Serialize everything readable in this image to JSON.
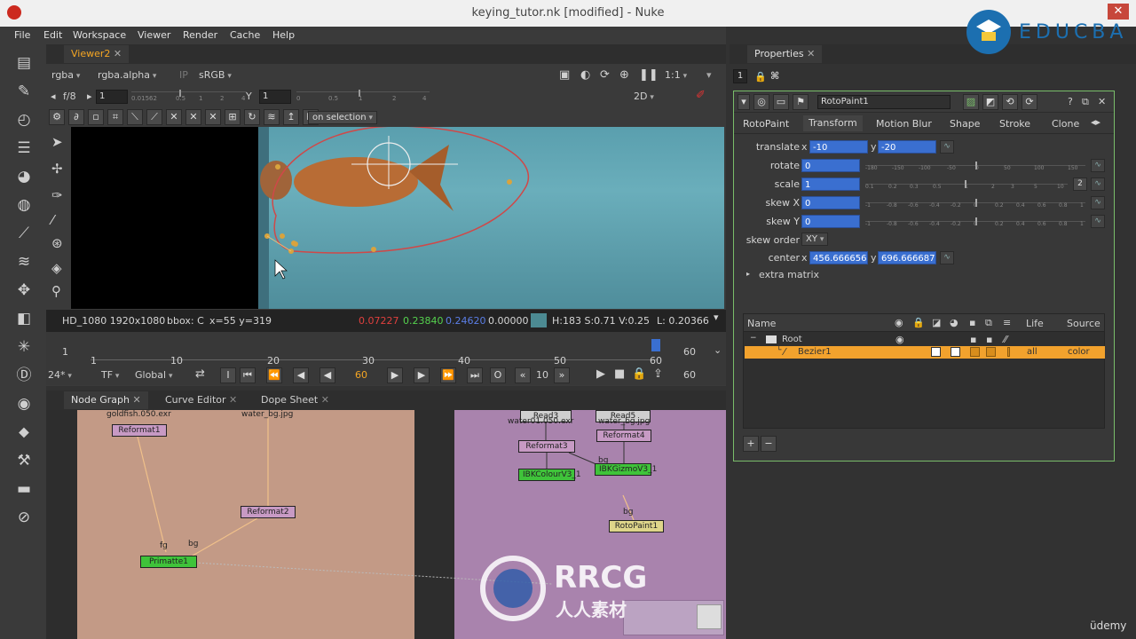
{
  "window": {
    "title": "keying_tutor.nk [modified] - Nuke",
    "close": "✕"
  },
  "menu": [
    "File",
    "Edit",
    "Workspace",
    "Viewer",
    "Render",
    "Cache",
    "Help"
  ],
  "viewer": {
    "tab": "Viewer2",
    "channels": "rgba",
    "alpha": "rgba.alpha",
    "colorspace": "sRGB",
    "zoom": "1:1",
    "mode": "2D",
    "fstop_label": "f/8",
    "gain_value": "1",
    "y_label": "Y",
    "gamma_value": "1",
    "gain_ticks": [
      "0.01562",
      "0.5",
      "1",
      "2",
      "4"
    ],
    "gamma_ticks": [
      "0",
      "0.5",
      "1",
      "2",
      "4"
    ],
    "roi_dropdown": "on selection",
    "info": {
      "format": "HD_1080 1920x1080",
      "bbox": "bbox: C",
      "coords": "x=55 y=319",
      "r": "0.07227",
      "g": "0.23840",
      "b": "0.24620",
      "a": "0.00000",
      "hsv": "H:183 S:0.71 V:0.25",
      "luma": "L: 0.20366"
    }
  },
  "timeline": {
    "start": "1",
    "end": "60",
    "end_right": "60",
    "ticks": [
      "1",
      "10",
      "20",
      "30",
      "40",
      "50",
      "60"
    ],
    "fps": "24*",
    "tf": "TF",
    "global": "Global",
    "current_frame": "60",
    "step": "10",
    "out_frame": "60"
  },
  "nodegraph": {
    "tabs": [
      "Node Graph",
      "Curve Editor",
      "Dope Sheet"
    ],
    "labels": {
      "goldfish_read": "goldfish.050.exr",
      "water_read": "water_bg.jpg",
      "reformat1": "Reformat1",
      "reformat2": "Reformat2",
      "primatte1": "Primatte1",
      "fg": "fg",
      "bg": "bg",
      "read_top1": "Read3",
      "read_top2": "Read5",
      "water_read2": "water01.050.exr",
      "water_bg2": "water_bg.jpg",
      "reformat3": "Reformat3",
      "reformat4": "Reformat4",
      "ibkcolour": "IBKColourV3_1",
      "ibkgizmo": "IBKGizmoV3_1",
      "bg2": "bg",
      "bg3": "bg",
      "rotopaint": "RotoPaint1"
    }
  },
  "properties": {
    "tab": "Properties",
    "counter": "1",
    "node_name": "RotoPaint1",
    "tabs": [
      "RotoPaint",
      "Transform",
      "Motion Blur",
      "Shape",
      "Stroke",
      "Clone"
    ],
    "translate": {
      "label": "translate",
      "x_label": "x",
      "x": "-10",
      "y_label": "y",
      "y": "-20"
    },
    "rotate": {
      "label": "rotate",
      "value": "0",
      "ticks": [
        "-180",
        "-150",
        "-100",
        "-50",
        "0",
        "50",
        "100",
        "150"
      ]
    },
    "scale": {
      "label": "scale",
      "value": "1",
      "ticks": [
        "0.1",
        "0.2",
        "0.3",
        "0.5",
        "1",
        "2",
        "3",
        "5",
        "10"
      ],
      "btn": "2"
    },
    "skew_x": {
      "label": "skew X",
      "value": "0",
      "ticks": [
        "-1",
        "-0.8",
        "-0.6",
        "-0.4",
        "-0.2",
        "0",
        "0.2",
        "0.4",
        "0.6",
        "0.8",
        "1"
      ]
    },
    "skew_y": {
      "label": "skew Y",
      "value": "0",
      "ticks": [
        "-1",
        "-0.8",
        "-0.6",
        "-0.4",
        "-0.2",
        "0",
        "0.2",
        "0.4",
        "0.6",
        "0.8",
        "1"
      ]
    },
    "skew_order": {
      "label": "skew order",
      "value": "XY"
    },
    "center": {
      "label": "center",
      "x_label": "x",
      "x": "456.666656",
      "y_label": "y",
      "y": "696.666687"
    },
    "extra_matrix": "extra matrix",
    "list_headers": {
      "name": "Name",
      "life": "Life",
      "source": "Source"
    },
    "root": "Root",
    "bezier": {
      "name": "Bezier1",
      "life": "all",
      "source": "color"
    },
    "add": "+",
    "remove": "−"
  },
  "watermark": {
    "educba": "EDUCBA",
    "rrcg": "RRCG",
    "rrcg_sub": "人人素材",
    "udemy": "üdemy"
  },
  "colors": {
    "accent": "#f5a623",
    "field_blue": "#3a6fd0",
    "panel_border": "#79bd6a"
  }
}
